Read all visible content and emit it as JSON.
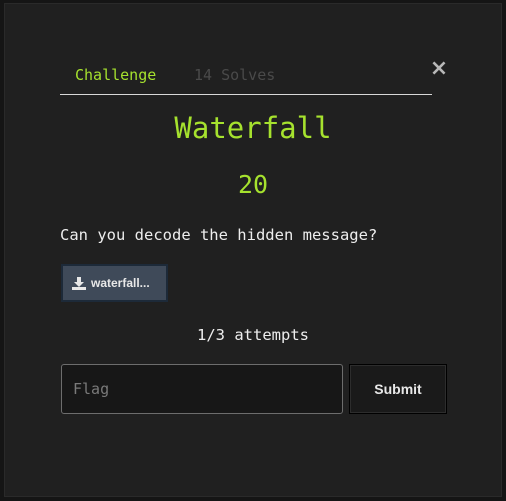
{
  "modal": {
    "close_glyph": "×",
    "tabs": [
      {
        "label": "Challenge",
        "active": true
      },
      {
        "label": "14 Solves",
        "active": false
      }
    ],
    "title": "Waterfall",
    "value": "20",
    "description": "Can you decode the hidden message?",
    "file": {
      "label": "waterfall...",
      "icon": "download-icon"
    },
    "attempts": "1/3 attempts",
    "flag_placeholder": "Flag",
    "submit_label": "Submit"
  },
  "colors": {
    "accent": "#a6e22e",
    "background": "#202020",
    "file_button": "#3f4a59"
  }
}
